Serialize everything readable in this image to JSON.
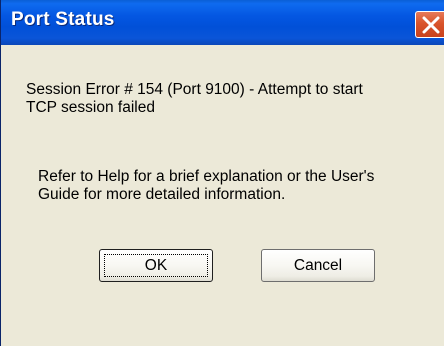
{
  "window": {
    "title": "Port Status"
  },
  "message": {
    "line1": "Session Error # 154  (Port 9100) - Attempt to start",
    "line2": "TCP session failed",
    "line3": "Refer to Help for a brief explanation or the User's",
    "line4": "Guide for more detailed information."
  },
  "buttons": {
    "ok_label": "OK",
    "cancel_label": "Cancel"
  },
  "icons": {
    "close": "close-icon"
  },
  "colors": {
    "titlebar": "#0150D8",
    "close_button": "#D9542B",
    "window_background": "#ECE9D8"
  }
}
